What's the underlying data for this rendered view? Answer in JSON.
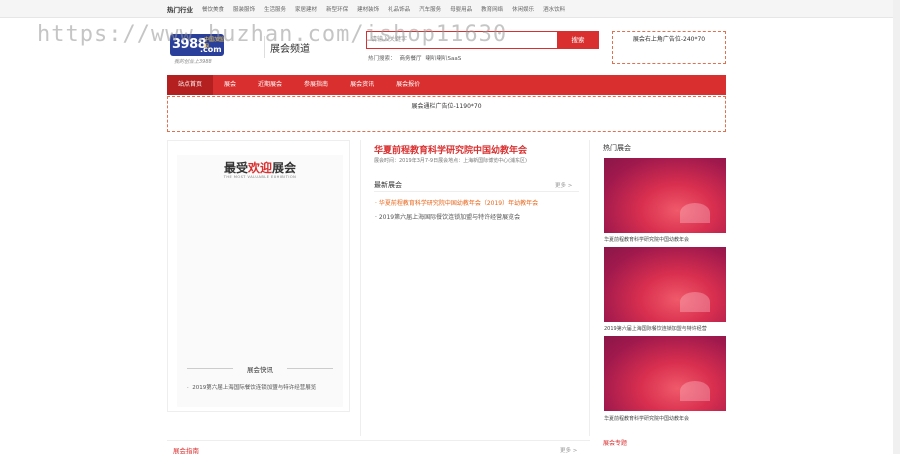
{
  "topbar": {
    "hot_label": "热门行业",
    "categories": [
      "餐饮美食",
      "服装服饰",
      "生活服务",
      "家居建材",
      "新型环保",
      "建材装饰",
      "礼品饰品",
      "汽车服务",
      "母婴用品",
      "教育网络",
      "休闲娱乐",
      "酒水饮料"
    ]
  },
  "logo": {
    "number": "3988",
    "domain": ".com",
    "tag": "中国加盟网",
    "slogan": "我的创业上3988"
  },
  "header": {
    "channel_title": "展会频道",
    "search_placeholder": "请输入关键字",
    "search_button": "搜索",
    "hot_search_label": "热门搜索：",
    "hot_search_keywords": [
      "商务餐厅",
      "喇叭喇叭SaaS"
    ],
    "ad_right": "展会右上角广告位-240*70"
  },
  "nav": {
    "items": [
      "站点首页",
      "展会",
      "近期展会",
      "参展指南",
      "展会资讯",
      "展会报价"
    ]
  },
  "ad_banner": "展会通栏广告位-1190*70",
  "left": {
    "popular_title_a": "最受",
    "popular_title_b": "欢迎",
    "popular_title_c": "展会",
    "popular_subtitle": "THE MOST VALUABLE EXHIBITION",
    "flash_title": "展会快讯",
    "flash_items": [
      "2019第六届上海国际餐饮连锁加盟与特许经营展览"
    ]
  },
  "middle": {
    "headline": "华夏前程教育科学研究院中国幼教年会",
    "meta": "展会时间：2019年3月7-9日展会地点：上海新国际博览中心(浦东区)",
    "newest_title": "最新展会",
    "more": "更多 >",
    "news": [
      {
        "text": "· 华夏前程教育科学研究院中国幼教年会（2019）年幼教年会",
        "color": "#e8651a"
      },
      {
        "text": "· 2019第六届上海国际餐饮连锁加盟与特许经营展览会",
        "color": "#555555"
      }
    ]
  },
  "right": {
    "title": "热门展会",
    "cards": [
      "华夏前程教育科学研究院中国幼教年会",
      "2019第六届上海国际餐饮连锁加盟与特许经营",
      "华夏前程教育科学研究院中国幼教年会"
    ],
    "bottom_title": "展会专题"
  },
  "guide": {
    "title": "展会指南",
    "more": "更多 >"
  },
  "watermark": "https://www.huzhan.com/ishop11630",
  "colors": {
    "brand_red": "#d92f2f",
    "nav_active": "#b3201f",
    "logo_blue": "#2a3f9a",
    "orange_link": "#e8651a"
  }
}
